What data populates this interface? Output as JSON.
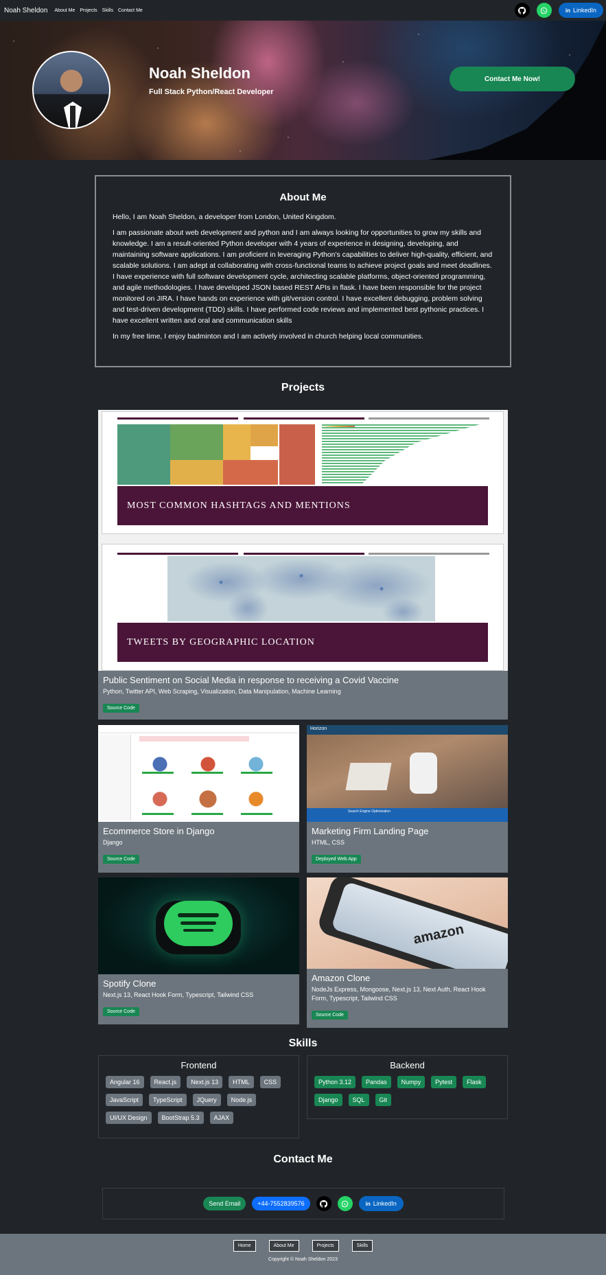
{
  "nav": {
    "brand": "Noah Sheldon",
    "links": [
      "About Me",
      "Projects",
      "Skills",
      "Contact Me"
    ],
    "linkedin": "LinkedIn"
  },
  "hero": {
    "name": "Noah Sheldon",
    "role": "Full Stack Python/React Developer",
    "cta": "Contact Me Now!"
  },
  "about": {
    "title": "About Me",
    "p1": "Hello, I am Noah Sheldon, a developer from London, United Kingdom.",
    "p2": "I am passionate about web development and python and I am always looking for opportunities to grow my skills and knowledge. I am a result-oriented Python developer with 4 years of experience in designing, developing, and maintaining software applications. I am proficient in leveraging Python's capabilities to deliver high-quality, efficient, and scalable solutions. I am adept at collaborating with cross-functional teams to achieve project goals and meet deadlines. I have experience with full software development cycle, architecting scalable platforms, object-oriented programming, and agile methodologies. I have developed JSON based REST APIs in flask. I have been responsible for the project monitored on JIRA. I have hands on experience with git/version control. I have excellent debugging, problem solving and test-driven development (TDD) skills. I have performed code reviews and implemented best pythonic practices. I have excellent written and oral and communication skills",
    "p3": "In my free time, I enjoy badminton and I am actively involved in church helping local communities."
  },
  "projects": {
    "title": "Projects",
    "covid": {
      "banner1": "MOST COMMON HASHTAGS AND MENTIONS",
      "banner2": "TWEETS BY GEOGRAPHIC LOCATION",
      "title": "Public Sentiment on Social Media in response to receiving a Covid Vaccine",
      "tags": "Python, Twitter API, Web Scraping, Visualization, Data Manipulation, Machine Learning",
      "button": "Source Code"
    },
    "ecommerce": {
      "title": "Ecommerce Store in Django",
      "tags": "Django",
      "button": "Source Code"
    },
    "marketing": {
      "title": "Marketing Firm Landing Page",
      "tags": "HTML, CSS",
      "button": "Deployed Web App",
      "brand": "Horizon",
      "section": "Search Engine Optimization"
    },
    "spotify": {
      "title": "Spotify Clone",
      "tags": "Next.js 13, React Hook Form, Typescript, Tailwind CSS",
      "button": "Source Code"
    },
    "amazon": {
      "title": "Amazon Clone",
      "tags": "NodeJs Express, Mongoose, Next.js 13, Next Auth, React Hook Form, Typescript, Tailwind CSS",
      "button": "Source Code",
      "logo": "amazon"
    }
  },
  "skills": {
    "title": "Skills",
    "frontend_title": "Frontend",
    "frontend": [
      "Angular 16",
      "React.js",
      "Next.js 13",
      "HTML",
      "CSS",
      "JavaScript",
      "TypeScript",
      "JQuery",
      "Node.js",
      "UI/UX Design",
      "BootStrap 5.3",
      "AJAX"
    ],
    "backend_title": "Backend",
    "backend": [
      "Python 3.12",
      "Pandas",
      "Numpy",
      "Pytest",
      "Flask",
      "Django",
      "SQL",
      "Git"
    ]
  },
  "contact": {
    "title": "Contact Me",
    "email": "Send Email",
    "phone": "+44-7552839576",
    "linkedin": "LinkedIn"
  },
  "footer": {
    "links": [
      "Home",
      "About Me",
      "Projects",
      "Skills"
    ],
    "copyright": "Copyright © Noah Sheldon 2023"
  },
  "colors": {
    "accent_green": "#198754",
    "card_gray": "#6c757d",
    "bg": "#212529",
    "linkedin_blue": "#0a66c2",
    "whatsapp_green": "#25d366",
    "phone_blue": "#0d6efd"
  }
}
